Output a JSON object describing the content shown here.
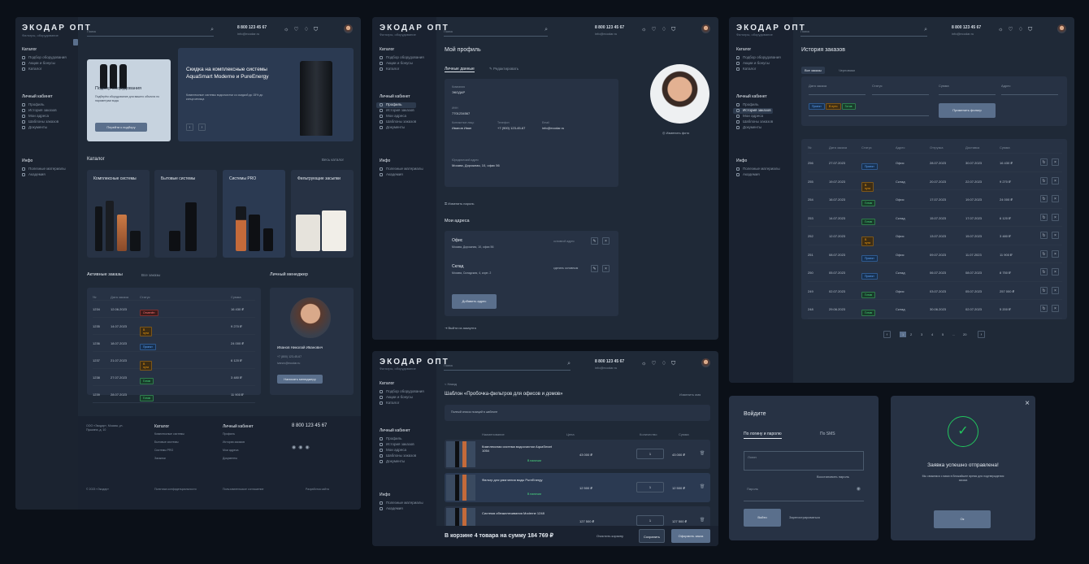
{
  "brand": {
    "logo": "ЭКОДАР ОПТ",
    "sub": "Фильтры, оборудование"
  },
  "search": {
    "placeholder": "Поиск"
  },
  "contact": {
    "phone": "8 800 123 45 67",
    "email": "info@ecodar.ru"
  },
  "sidebar": {
    "catalog_title": "Каталог",
    "catalog": [
      "Подбор оборудования",
      "Акции и бонусы",
      "Каталог"
    ],
    "personal_title": "Личный кабинет",
    "personal": [
      "Профиль",
      "История заказов",
      "Мои адреса",
      "Шаблоны заказов",
      "Документы"
    ],
    "info_title": "Инфо",
    "info": [
      "Полезные материалы",
      "Академия"
    ]
  },
  "home": {
    "promo1": {
      "title": "Подбор оборудования",
      "text": "Подберём оборудование для вашего объекта по параметрам воды",
      "button": "Перейти к подбору"
    },
    "promo2": {
      "title": "Скидка на комплексные системы AquaSmart Moderne и PureEnergy",
      "text": "Комплексные системы водоочистки со скидкой до 15% до конца месяца"
    },
    "catalog_title": "Каталог",
    "catalog_all": "Весь каталог",
    "categories": [
      "Комплексные системы",
      "Бытовые системы",
      "Системы PRO",
      "Фильтрующие засыпки"
    ],
    "orders_title": "Активные заказы",
    "orders_all": "Все заказы",
    "orders_head": [
      "№",
      "Дата заказа",
      "Статус",
      "Сумма"
    ],
    "orders": [
      {
        "no": "1234",
        "date": "12.06.2023",
        "status": "Отменён",
        "tone": "r",
        "sum": "16 430 ₽"
      },
      {
        "no": "1235",
        "date": "14.07.2023",
        "status": "В пути",
        "tone": "o",
        "sum": "9 270 ₽"
      },
      {
        "no": "1236",
        "date": "18.07.2023",
        "status": "Принят",
        "tone": "b",
        "sum": "24 000 ₽"
      },
      {
        "no": "1237",
        "date": "21.07.2023",
        "status": "В пути",
        "tone": "o",
        "sum": "6 120 ₽"
      },
      {
        "no": "1238",
        "date": "27.07.2023",
        "status": "Готов",
        "tone": "g",
        "sum": "3 480 ₽"
      },
      {
        "no": "1239",
        "date": "28.07.2023",
        "status": "Готов",
        "tone": "g",
        "sum": "11 900 ₽"
      }
    ],
    "manager_title": "Личный менеджер",
    "manager_name": "Иванов Николай Иванович",
    "manager_phone": "+7 (800) 123-45-67",
    "manager_mail": "ivanov@ecodar.ru",
    "manager_button": "Написать менеджеру",
    "footer": {
      "address": "ООО «Экодар», Москва, ул. Пушкина, д. 10",
      "col1_title": "Каталог",
      "col1": [
        "Комплексные системы",
        "Бытовые системы",
        "Системы PRO",
        "Засыпки"
      ],
      "col2_title": "Личный кабинет",
      "col2": [
        "Профиль",
        "История заказов",
        "Мои адреса",
        "Документы"
      ],
      "phone": "8 800 123 45 67",
      "copy": "© 2023 «Экодар»",
      "policy": "Политика конфиденциальности",
      "terms": "Пользовательское соглашение",
      "dev": "Разработка сайта"
    }
  },
  "profile": {
    "title": "Мой профиль",
    "tab1": "Личные данные",
    "tab2": "Редактировать",
    "fields": [
      [
        "Компания",
        "ЭКОДАР"
      ],
      [
        "ИНН",
        "7701234567"
      ],
      [
        "Контактное лицо",
        "Иванов Иван"
      ],
      [
        "Телефон",
        "+7 (900) 123-45-67"
      ],
      [
        "Email",
        "info@ecodar.ru"
      ]
    ],
    "address_label": "Юридический адрес",
    "address": "Москва, Дорожная, 10, офис 56",
    "change_photo": "Изменить фото",
    "addresses_title": "Мои адреса",
    "addr1_title": "Офис",
    "addr1_text": "Москва, Дорожная, 10, офис 56",
    "addr1_tag": "основной адрес",
    "addr2_title": "Склад",
    "addr2_text": "Москва, Складская, 4, корп. 2",
    "addr2_tag": "сделать основным",
    "add_address": "Добавить адрес",
    "change_password": "Изменить пароль",
    "logout": "Выйти из аккаунта"
  },
  "history": {
    "title": "История заказов",
    "tab1": "Все заказы",
    "tab2": "Черновики",
    "filters": [
      "Дата заказа",
      "Статус",
      "Сумма",
      "Адрес"
    ],
    "filter_button": "Применить фильтр",
    "head": [
      "№",
      "Дата заказа",
      "Статус",
      "Адрес",
      "Отгрузка",
      "Доставка",
      "Сумма"
    ],
    "rows": [
      {
        "no": "256",
        "date": "27.07.2023",
        "status": "Принят",
        "tone": "b",
        "addr": "Офис",
        "ship": "28.07.2023",
        "deliv": "30.07.2023",
        "sum": "16 430 ₽"
      },
      {
        "no": "255",
        "date": "19.07.2023",
        "status": "В пути",
        "tone": "o",
        "addr": "Склад",
        "ship": "20.07.2023",
        "deliv": "22.07.2023",
        "sum": "9 270 ₽"
      },
      {
        "no": "254",
        "date": "16.07.2023",
        "status": "Готов",
        "tone": "g",
        "addr": "Офис",
        "ship": "17.07.2023",
        "deliv": "19.07.2023",
        "sum": "24 000 ₽"
      },
      {
        "no": "253",
        "date": "14.07.2023",
        "status": "Готов",
        "tone": "g",
        "addr": "Склад",
        "ship": "15.07.2023",
        "deliv": "17.07.2023",
        "sum": "6 120 ₽"
      },
      {
        "no": "252",
        "date": "12.07.2023",
        "status": "В пути",
        "tone": "o",
        "addr": "Офис",
        "ship": "13.07.2023",
        "deliv": "15.07.2023",
        "sum": "3 480 ₽"
      },
      {
        "no": "251",
        "date": "08.07.2023",
        "status": "Принят",
        "tone": "b",
        "addr": "Офис",
        "ship": "09.07.2023",
        "deliv": "11.07.2023",
        "sum": "11 900 ₽"
      },
      {
        "no": "250",
        "date": "05.07.2023",
        "status": "Принят",
        "tone": "b",
        "addr": "Склад",
        "ship": "06.07.2023",
        "deliv": "08.07.2023",
        "sum": "8 750 ₽"
      },
      {
        "no": "249",
        "date": "02.07.2023",
        "status": "Готов",
        "tone": "g",
        "addr": "Офис",
        "ship": "03.07.2023",
        "deliv": "05.07.2023",
        "sum": "257 000 ₽"
      },
      {
        "no": "248",
        "date": "29.06.2023",
        "status": "Готов",
        "tone": "g",
        "addr": "Склад",
        "ship": "30.06.2023",
        "deliv": "02.07.2023",
        "sum": "5 200 ₽"
      }
    ],
    "pages": [
      "1",
      "2",
      "3",
      "4",
      "5",
      "...",
      "20"
    ]
  },
  "template": {
    "back": "< Назад",
    "title": "Шаблон «Пробочка-фильтров для офисов и домов»",
    "edit": "Изменить имя",
    "note": "Полный список позиций в шаблоне",
    "head": [
      "Наименование",
      "Цена",
      "Количество",
      "Сумма"
    ],
    "items": [
      {
        "name": "Комплексная система водоочистки AquaSmart 1054",
        "stock": "В наличии",
        "price": "43 000 ₽",
        "qty": "1",
        "sum": "43 000 ₽"
      },
      {
        "name": "Фильтр для умягчения воды PureEnergy",
        "stock": "В наличии",
        "price": "12 500 ₽",
        "qty": "1",
        "sum": "12 500 ₽"
      },
      {
        "name": "Система обезжелезивания Moderne 1248",
        "stock": "В наличии",
        "price": "127 500 ₽",
        "qty": "1",
        "sum": "127 500 ₽"
      }
    ],
    "total": "В корзине 4 товара на сумму 184 769 ₽",
    "clear": "Очистить корзину",
    "save": "Сохранить",
    "checkout": "Оформить заказ"
  },
  "login": {
    "title": "Войдите",
    "tab1": "По логину и паролю",
    "tab2": "По SMS",
    "login_ph": "Логин",
    "pass_ph": "Пароль",
    "forgot": "Восстановить пароль",
    "enter": "Войти",
    "register": "Зарегистрироваться"
  },
  "success": {
    "title": "Заявка успешно отправлена!",
    "text": "Мы свяжемся с вами в ближайшее время для подтверждения заказа",
    "button": "Ок"
  },
  "colors": {
    "accent": "#5a6f8c",
    "success": "#22c55e"
  }
}
